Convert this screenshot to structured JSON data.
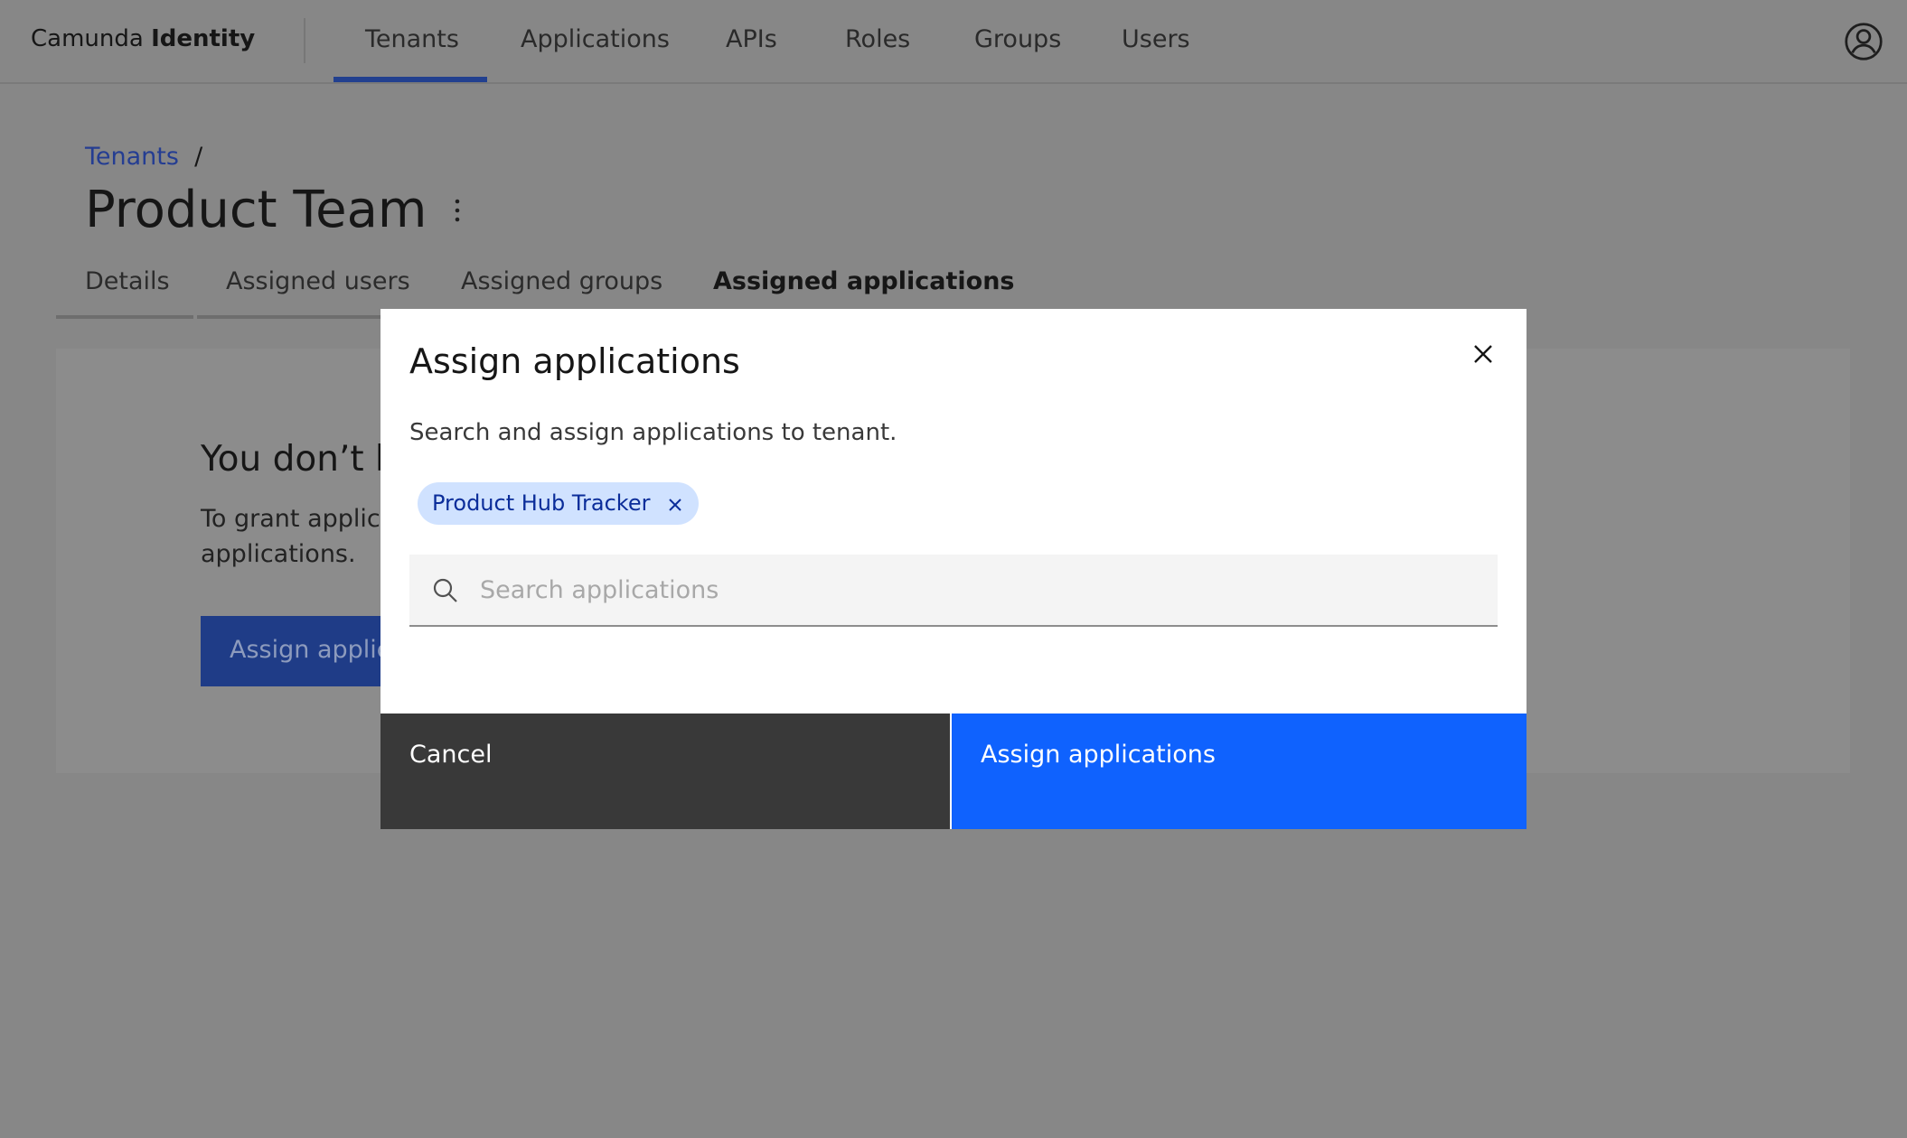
{
  "header": {
    "brand_light": "Camunda",
    "brand_bold": "Identity",
    "nav": [
      "Tenants",
      "Applications",
      "APIs",
      "Roles",
      "Groups",
      "Users"
    ],
    "active_nav": "Tenants"
  },
  "breadcrumb": {
    "link": "Tenants",
    "separator": "/"
  },
  "page": {
    "title": "Product Team",
    "tabs": [
      "Details",
      "Assigned users",
      "Assigned groups",
      "Assigned applications"
    ],
    "active_tab": "Assigned applications"
  },
  "empty_state": {
    "heading": "You don’t h",
    "text_line1": "To grant applica",
    "text_line2": "applications.",
    "button": "Assign applic"
  },
  "modal": {
    "title": "Assign applications",
    "description": "Search and assign applications to tenant.",
    "selected_tags": [
      "Product Hub Tracker"
    ],
    "search_placeholder": "Search applications",
    "search_value": "",
    "cancel": "Cancel",
    "submit": "Assign applications"
  },
  "colors": {
    "primary": "#0f62fe",
    "tag_bg": "#d0e2ff",
    "secondary": "#393939"
  }
}
